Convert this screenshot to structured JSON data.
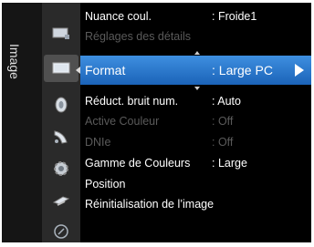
{
  "sidebar": {
    "title": "Image"
  },
  "icons": [
    {
      "name": "input-icon"
    },
    {
      "name": "picture-icon"
    },
    {
      "name": "sound-icon"
    },
    {
      "name": "channel-icon"
    },
    {
      "name": "setup-icon"
    },
    {
      "name": "input-source-icon"
    },
    {
      "name": "support-icon"
    }
  ],
  "menu": {
    "items": [
      {
        "label": "Nuance coul.",
        "value": ": Froide1",
        "state": "normal"
      },
      {
        "label": "Réglages des détails",
        "value": "",
        "state": "dim"
      },
      {
        "label": "Format",
        "value": ": Large PC",
        "state": "selected"
      },
      {
        "label": "Réduct. bruit num.",
        "value": ": Auto",
        "state": "normal"
      },
      {
        "label": "Active Couleur",
        "value": ": Off",
        "state": "dim"
      },
      {
        "label": "DNIe",
        "value": ": Off",
        "state": "dim"
      },
      {
        "label": "Gamme de Couleurs",
        "value": ": Large",
        "state": "normal"
      },
      {
        "label": "Position",
        "value": "",
        "state": "normal"
      },
      {
        "label": "Réinitialisation de l’image",
        "value": "",
        "state": "normal"
      }
    ]
  },
  "colors": {
    "highlight_top": "#3e8fe0",
    "highlight_bottom": "#1b63b8",
    "dim_text": "#5a5a5a"
  }
}
